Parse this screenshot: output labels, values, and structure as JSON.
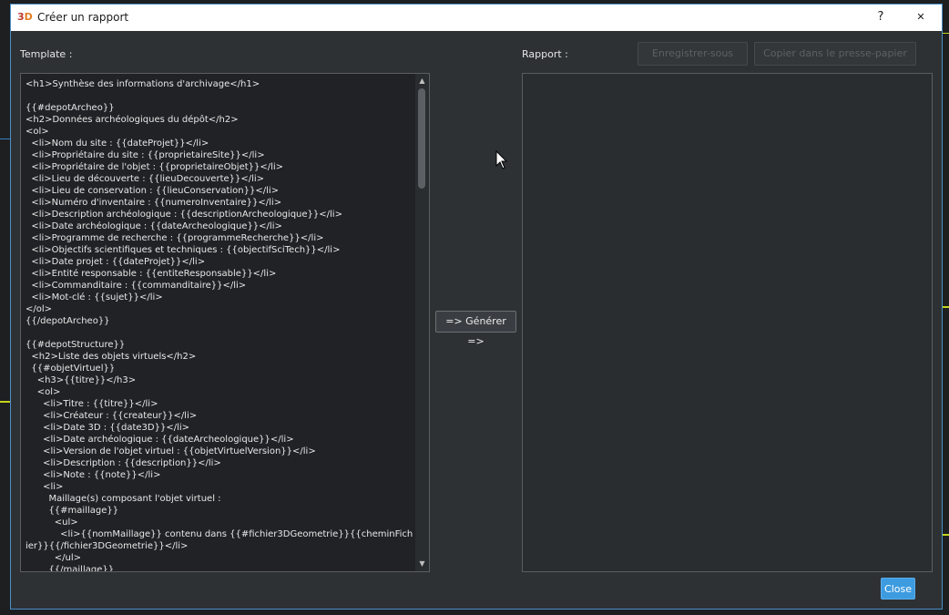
{
  "window": {
    "title": "Créer un rapport",
    "help_label": "?",
    "close_glyph": "✕",
    "icon_text": "3D"
  },
  "labels": {
    "template": "Template :",
    "rapport": "Rapport :"
  },
  "toolbar": {
    "save_as_label": "Enregistrer-sous",
    "copy_label": "Copier dans le presse-papier"
  },
  "template": {
    "content": "<h1>Synthèse des informations d'archivage</h1>\n\n{{#depotArcheo}}\n<h2>Données archéologiques du dépôt</h2>\n<ol>\n  <li>Nom du site : {{dateProjet}}</li>\n  <li>Propriétaire du site : {{proprietaireSite}}</li>\n  <li>Propriétaire de l'objet : {{proprietaireObjet}}</li>\n  <li>Lieu de découverte : {{lieuDecouverte}}</li>\n  <li>Lieu de conservation : {{lieuConservation}}</li>\n  <li>Numéro d'inventaire : {{numeroInventaire}}</li>\n  <li>Description archéologique : {{descriptionArcheologique}}</li>\n  <li>Date archéologique : {{dateArcheologique}}</li>\n  <li>Programme de recherche : {{programmeRecherche}}</li>\n  <li>Objectifs scientifiques et techniques : {{objectifSciTech}}</li>\n  <li>Date projet : {{dateProjet}}</li>\n  <li>Entité responsable : {{entiteResponsable}}</li>\n  <li>Commanditaire : {{commanditaire}}</li>\n  <li>Mot-clé : {{sujet}}</li>\n</ol>\n{{/depotArcheo}}\n\n{{#depotStructure}}\n  <h2>Liste des objets virtuels</h2>\n  {{#objetVirtuel}}\n    <h3>{{titre}}</h3>\n    <ol>\n      <li>Titre : {{titre}}</li>\n      <li>Créateur : {{createur}}</li>\n      <li>Date 3D : {{date3D}}</li>\n      <li>Date archéologique : {{dateArcheologique}}</li>\n      <li>Version de l'objet virtuel : {{objetVirtuelVersion}}</li>\n      <li>Description : {{description}}</li>\n      <li>Note : {{note}}</li>\n      <li>\n        Maillage(s) composant l'objet virtuel :\n        {{#maillage}}\n          <ul>\n            <li>{{nomMaillage}} contenu dans {{#fichier3DGeometrie}}{{cheminFichier}}{{/fichier3DGeometrie}}</li>\n          </ul>\n        {{/maillage}}"
  },
  "report": {
    "content": ""
  },
  "actions": {
    "generate_label": "=> Générer =>",
    "close_label": "Close"
  },
  "colors": {
    "accent": "#3d9be0",
    "dialog_bg": "#2e3134",
    "editor_bg": "#202225",
    "bg_highlight": "#c4d31c"
  }
}
